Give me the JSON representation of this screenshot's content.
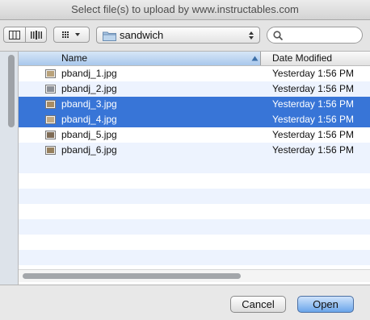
{
  "window": {
    "title": "Select file(s) to upload by www.instructables.com"
  },
  "toolbar": {
    "view_icons": [
      "columns-view-icon",
      "coverflow-view-icon"
    ],
    "arrange_icon": "grid-arrange-icon",
    "location": "sandwich",
    "search": {
      "value": "",
      "placeholder": ""
    }
  },
  "columns": {
    "name": "Name",
    "date": "Date Modified",
    "sort": "ascending"
  },
  "files": [
    {
      "name": "pbandj_1.jpg",
      "date": "Yesterday 1:56 PM",
      "selected": false
    },
    {
      "name": "pbandj_2.jpg",
      "date": "Yesterday 1:56 PM",
      "selected": false
    },
    {
      "name": "pbandj_3.jpg",
      "date": "Yesterday 1:56 PM",
      "selected": true
    },
    {
      "name": "pbandj_4.jpg",
      "date": "Yesterday 1:56 PM",
      "selected": true
    },
    {
      "name": "pbandj_5.jpg",
      "date": "Yesterday 1:56 PM",
      "selected": false
    },
    {
      "name": "pbandj_6.jpg",
      "date": "Yesterday 1:56 PM",
      "selected": false
    }
  ],
  "buttons": {
    "cancel": "Cancel",
    "open": "Open"
  },
  "colors": {
    "selection": "#3875d7",
    "stripe": "#edf3fe",
    "header_active": "#a9c8ec"
  }
}
